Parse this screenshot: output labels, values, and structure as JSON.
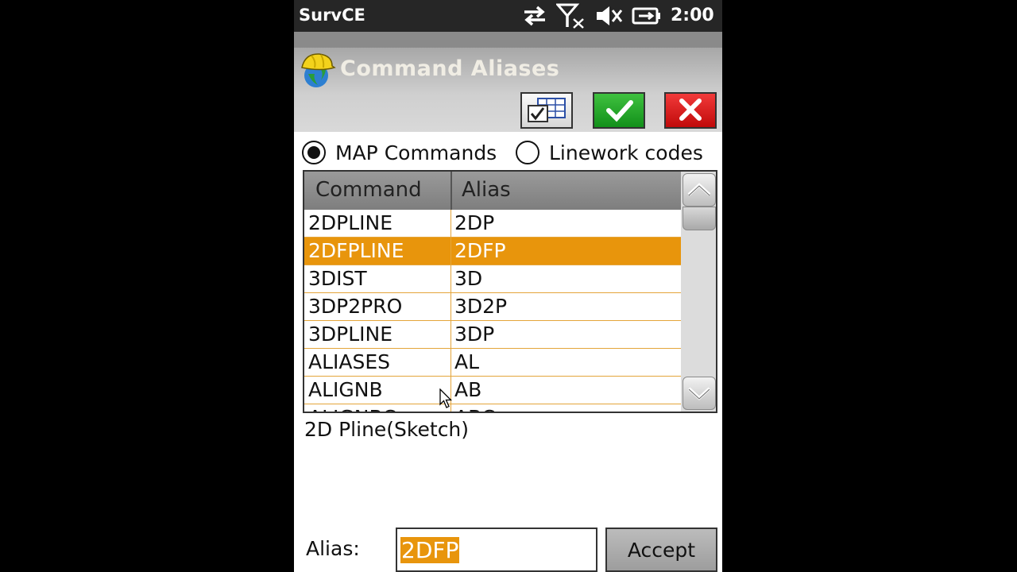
{
  "status_bar": {
    "app_name": "SurvCE",
    "time": "2:00",
    "icons": [
      "sync-arrows-icon",
      "no-signal-icon",
      "speaker-muted-icon",
      "battery-charging-icon"
    ]
  },
  "header": {
    "title": "Command Aliases",
    "logo_icon": "surveyor-helmet-logo",
    "buttons": {
      "grid": "grid-checklist-icon",
      "ok": "checkmark-icon",
      "cancel": "close-icon"
    }
  },
  "radio": {
    "map_label": "MAP Commands",
    "linework_label": "Linework codes",
    "selected": "map"
  },
  "table": {
    "headers": {
      "command": "Command",
      "alias": "Alias"
    },
    "rows": [
      {
        "command": "2DPLINE",
        "alias": "2DP"
      },
      {
        "command": "2DFPLINE",
        "alias": "2DFP",
        "selected": true
      },
      {
        "command": "3DIST",
        "alias": "3D"
      },
      {
        "command": "3DP2PRO",
        "alias": "3D2P"
      },
      {
        "command": "3DPLINE",
        "alias": "3DP"
      },
      {
        "command": "ALIASES",
        "alias": "AL"
      },
      {
        "command": "ALIGNB",
        "alias": "AB"
      },
      {
        "command": "ALIGNBC",
        "alias": "ABC"
      }
    ]
  },
  "description": "2D Pline(Sketch)",
  "alias_field": {
    "label": "Alias:",
    "value": "2DFP"
  },
  "accept_label": "Accept",
  "colors": {
    "selection": "#e8950c",
    "ok_green": "#12901a",
    "cancel_red": "#c00a0a"
  }
}
